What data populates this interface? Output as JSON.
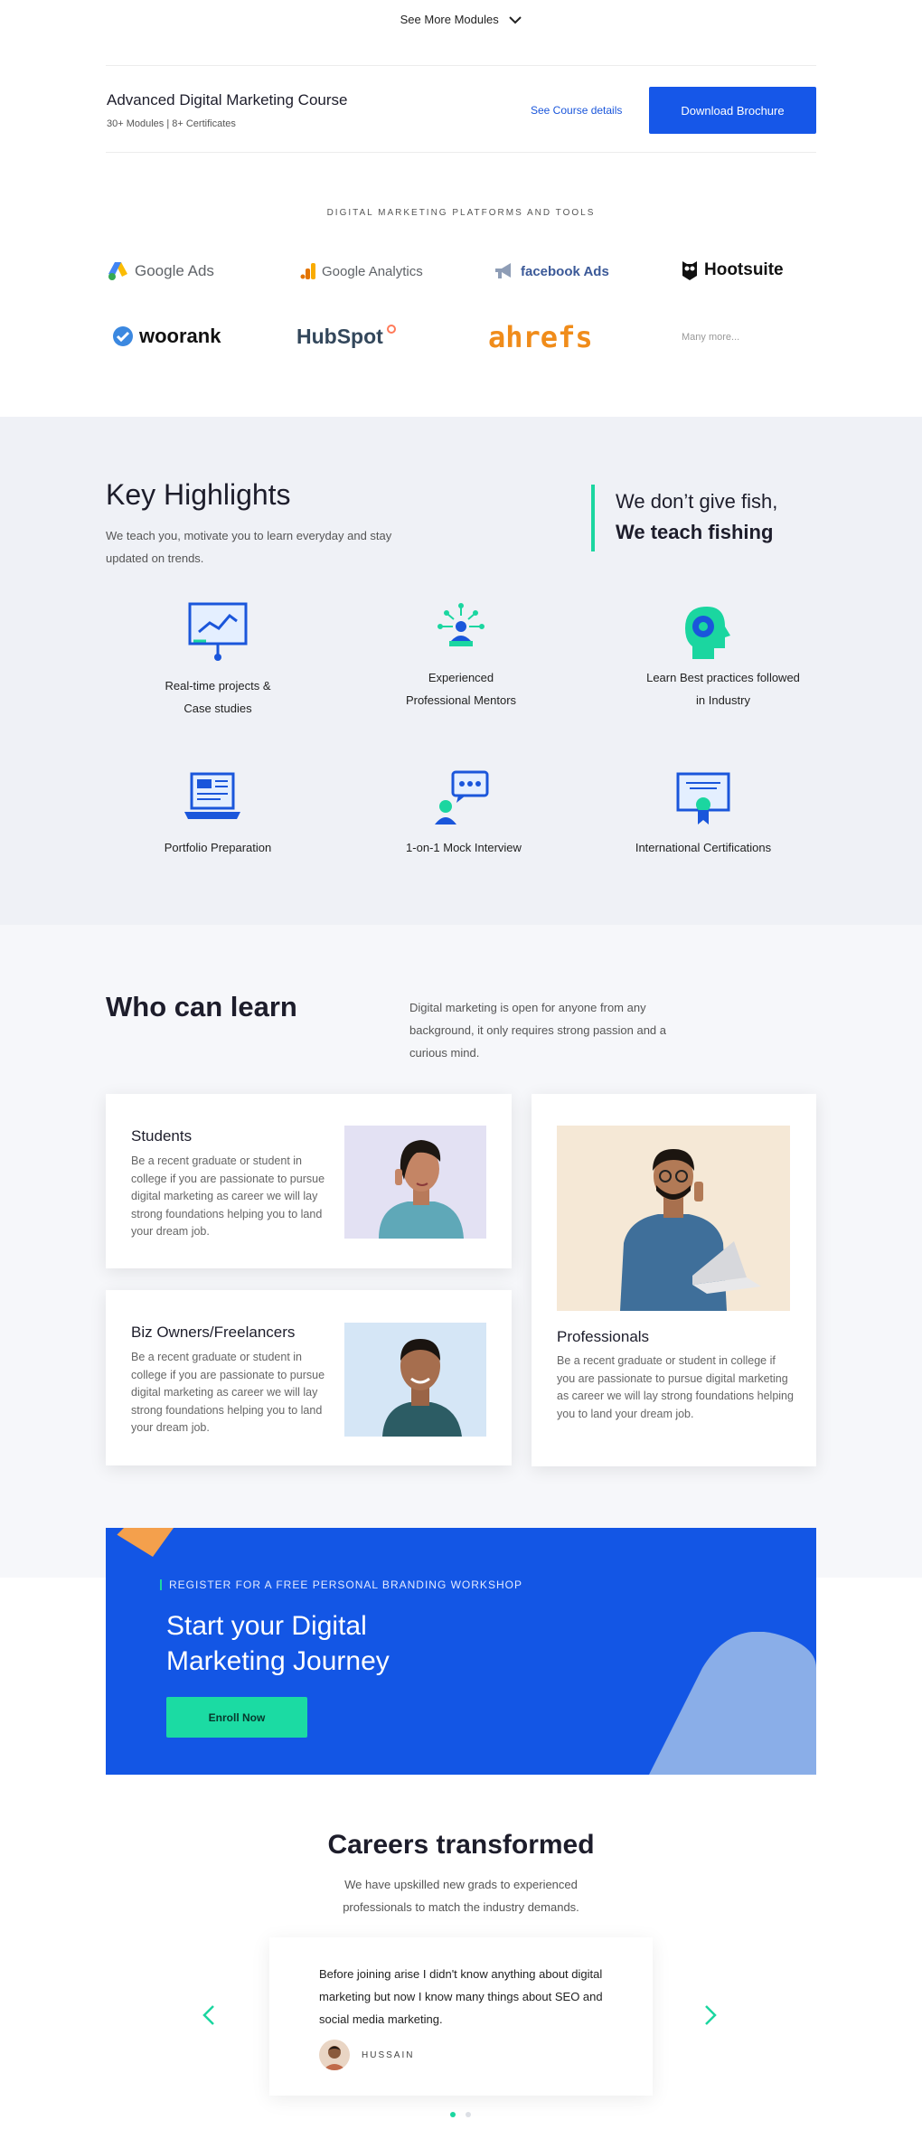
{
  "modules": {
    "see_more_label": "See More Modules"
  },
  "course": {
    "title": "Advanced Digital Marketing Course",
    "meta": "30+ Modules | 8+ Certificates",
    "details_link": "See Course details",
    "download_label": "Download Brochure"
  },
  "tools": {
    "heading": "DIGITAL MARKETING PLATFORMS AND TOOLS",
    "items": [
      {
        "name": "Google Ads",
        "icon": "google-ads-icon"
      },
      {
        "name": "Google Analytics",
        "icon": "google-analytics-icon"
      },
      {
        "name": "facebook Ads",
        "icon": "facebook-megaphone-icon"
      },
      {
        "name": "Hootsuite",
        "icon": "hootsuite-owl-icon"
      },
      {
        "name": "woorank",
        "icon": "woorank-check-icon"
      },
      {
        "name": "HubSpot",
        "icon": "hubspot-sprocket-icon"
      },
      {
        "name": "ahrefs",
        "icon": ""
      },
      {
        "name": "Many more...",
        "icon": ""
      }
    ]
  },
  "highlights": {
    "title": "Key Highlights",
    "subtitle": "We teach you, motivate you to learn everyday and stay updated on trends.",
    "quote_line1": "We don’t give fish,",
    "quote_line2": "We teach fishing",
    "items": [
      {
        "label_line1": "Real-time projects &",
        "label_line2": "Case studies",
        "icon": "presentation-chart-icon"
      },
      {
        "label_line1": "Experienced",
        "label_line2": "Professional Mentors",
        "icon": "mentor-network-icon"
      },
      {
        "label_line1": "Learn Best practices followed",
        "label_line2": "in Industry",
        "icon": "head-gear-icon"
      },
      {
        "label_line1": "Portfolio Preparation",
        "label_line2": "",
        "icon": "laptop-portfolio-icon"
      },
      {
        "label_line1": "1-on-1 Mock Interview",
        "label_line2": "",
        "icon": "chat-person-icon"
      },
      {
        "label_line1": "International Certifications",
        "label_line2": "",
        "icon": "certificate-icon"
      }
    ]
  },
  "who": {
    "title": "Who can learn",
    "description": "Digital marketing is open for anyone from any background, it only requires strong passion and a curious mind.",
    "cards": [
      {
        "title": "Students",
        "text": "Be a recent graduate or student in college if you are passionate to pursue digital marketing as career we will lay strong foundations helping you to land your dream job."
      },
      {
        "title": "Biz Owners/Freelancers",
        "text": "Be a recent graduate or student in college if you are passionate to pursue digital marketing as career we will lay strong foundations helping you to land your dream job."
      },
      {
        "title": "Professionals",
        "text": "Be a recent graduate or student in college if you are passionate to pursue digital marketing as career we will lay strong foundations helping you to land your dream job."
      }
    ]
  },
  "cta": {
    "tag": "REGISTER FOR A FREE PERSONAL BRANDING WORKSHOP",
    "title_line1": "Start your Digital",
    "title_line2": "Marketing Journey",
    "button": "Enroll Now"
  },
  "careers": {
    "title": "Careers transformed",
    "subtitle_line1": "We have upskilled new grads to experienced",
    "subtitle_line2": "professionals to match the industry demands.",
    "testimonial_text": "Before joining arise I didn't know anything about digital marketing but now I know many things about SEO and social media marketing.",
    "testimonial_name": "HUSSAIN"
  },
  "colors": {
    "brand_blue": "#1356e5",
    "accent_green": "#1bd6a0",
    "orange": "#f4a04c"
  }
}
